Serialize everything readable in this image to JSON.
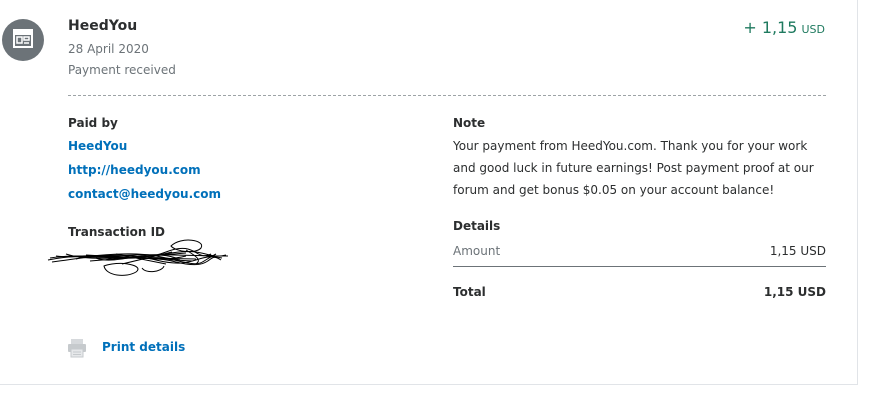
{
  "transaction": {
    "merchant": "HeedYou",
    "date": "28 April 2020",
    "status": "Payment received",
    "amount": "+ 1,15",
    "currency": "USD"
  },
  "paid_by": {
    "label": "Paid by",
    "name": "HeedYou",
    "website": "http://heedyou.com",
    "email": "contact@heedyou.com"
  },
  "transaction_id": {
    "label": "Transaction ID"
  },
  "note": {
    "label": "Note",
    "text": "Your payment from HeedYou.com. Thank you for your work and good luck in future earnings! Post payment proof at our forum and get bonus $0.05 on your account balance!"
  },
  "details": {
    "label": "Details",
    "amount_label": "Amount",
    "amount_value": "1,15 USD",
    "total_label": "Total",
    "total_value": "1,15 USD"
  },
  "actions": {
    "print_label": "Print details"
  },
  "icons": {
    "avatar": "storefront-icon",
    "print": "printer-icon"
  },
  "colors": {
    "accent_link": "#0070ba",
    "amount_positive": "#1f7a5f",
    "avatar_bg": "#6c7378"
  }
}
